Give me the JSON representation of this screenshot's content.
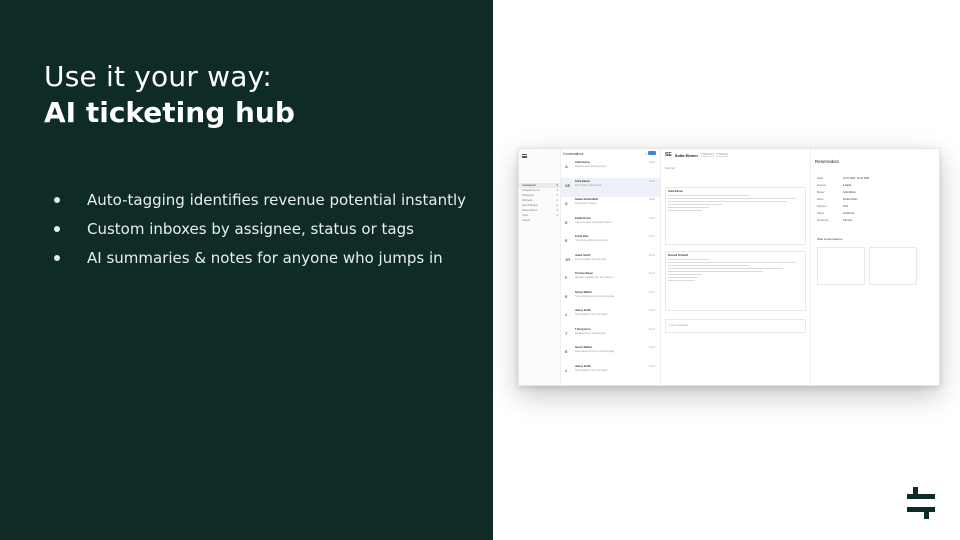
{
  "headline": {
    "line1": "Use it your way:",
    "line2": "AI ticketing hub"
  },
  "bullets": [
    "Auto-tagging identifies revenue potential instantly",
    "Custom inboxes by assignee, status or tags",
    "AI summaries & notes for anyone who jumps in"
  ],
  "app": {
    "conversations_title": "Conversations",
    "conversation_rows": [
      {
        "initial": "A",
        "name": "Anita Kemp",
        "snippet": "Wellness and booking enquiry",
        "time": "Today"
      },
      {
        "initial": "SE",
        "name": "Sofia Ebmer",
        "snippet": "Room Types / Rates and ...",
        "time": "Today"
      },
      {
        "initial": "S",
        "name": "Stefan Rothenfield",
        "snippet": "Cancellation request",
        "time": "Today"
      },
      {
        "initial": "E",
        "name": "Emilia Knust",
        "snippet": "I have a couple of questions about ...",
        "time": "Sep 6"
      },
      {
        "initial": "E",
        "name": "Frank Vasz",
        "snippet": "Your private parking at the hotel",
        "time": "Sep 6"
      },
      {
        "initial": "JR",
        "name": "Jamie Smith",
        "snippet": "Some question about the spa",
        "time": "Sep 6"
      },
      {
        "initial": "F",
        "name": "Thomas Bauer",
        "snippet": "Question regarding the late check-in",
        "time": "Sep 6"
      },
      {
        "initial": "E",
        "name": "Simon Willem",
        "snippet": "Some detail about my upcoming stay",
        "time": "Sep 6"
      },
      {
        "initial": "J",
        "name": "James Smith",
        "snippet": "Some detail on the reservation",
        "time": "Sep 6"
      },
      {
        "initial": "T",
        "name": "T Bergstrom",
        "snippet": "Breakfast times and allergies",
        "time": "Sep 6"
      },
      {
        "initial": "E",
        "name": "Simon Willem",
        "snippet": "Some detail about my upcoming stay",
        "time": "Sep 6"
      },
      {
        "initial": "J",
        "name": "James Smith",
        "snippet": "Some detail on the reservation",
        "time": "Sep 6"
      }
    ],
    "chat": {
      "initials": "SE",
      "name": "Sofia Ebmer",
      "tag1": "High value",
      "tag2": "Revenue",
      "summary_label": "Summary",
      "message1_sender": "Sofia Ebmer",
      "message2_sender": "Russell Schauth",
      "type_placeholder": "Type a message"
    },
    "reservation": {
      "title": "Reservation",
      "past_title": "Past conversations",
      "rows": [
        {
          "k": "Dates",
          "v": "01.10.2025 - 04.10.2025"
        },
        {
          "k": "Persons",
          "v": "2 adults"
        },
        {
          "k": "Booker",
          "v": "Sofia Ebmer"
        },
        {
          "k": "Room",
          "v": "Double Room"
        },
        {
          "k": "Payment",
          "v": "Paid"
        },
        {
          "k": "Status",
          "v": "Confirmed"
        },
        {
          "k": "Preference",
          "v": "Top floor"
        }
      ]
    },
    "nav_items": [
      "Unassigned",
      "Assigned to me",
      "Followups",
      "Wellness",
      "Spa & Beauty",
      "Reservations",
      "Open",
      "Closed"
    ]
  }
}
